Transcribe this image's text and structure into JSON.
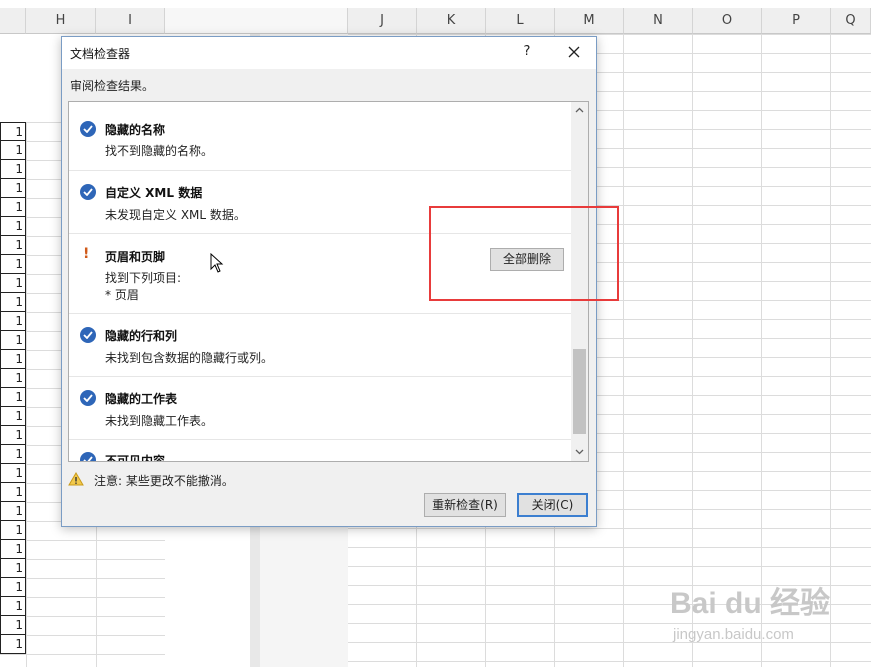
{
  "sheet": {
    "columns_left": [
      "H",
      "I"
    ],
    "columns_right": [
      "J",
      "K",
      "L",
      "M",
      "N",
      "O",
      "P",
      "Q"
    ],
    "cell_value": "1"
  },
  "dialog": {
    "title": "文档检查器",
    "help_label": "?",
    "subtitle": "审阅检查结果。",
    "items": [
      {
        "title": "隐藏的名称",
        "desc": "找不到隐藏的名称。",
        "status": "ok"
      },
      {
        "title": "自定义 XML 数据",
        "desc": "未发现自定义 XML 数据。",
        "status": "ok"
      },
      {
        "title": "页眉和页脚",
        "desc": "找到下列项目:",
        "desc2": "* 页眉",
        "status": "warning",
        "action_label": "全部删除"
      },
      {
        "title": "隐藏的行和列",
        "desc": "未找到包含数据的隐藏行或列。",
        "status": "ok"
      },
      {
        "title": "隐藏的工作表",
        "desc": "未找到隐藏工作表。",
        "status": "ok"
      },
      {
        "title": "不可见内容",
        "status": "ok"
      }
    ],
    "warning_mark": "!",
    "note": "注意: 某些更改不能撤消。",
    "reinspect_label": "重新检查(R)",
    "close_label": "关闭(C)"
  },
  "watermark": {
    "brand": "Bai du 经验",
    "url": "jingyan.baidu.com"
  },
  "colors": {
    "check": "#2e66b8",
    "warning": "#d05a1a",
    "highlight": "#e83b3b",
    "default_button_border": "#3c7fd0"
  }
}
